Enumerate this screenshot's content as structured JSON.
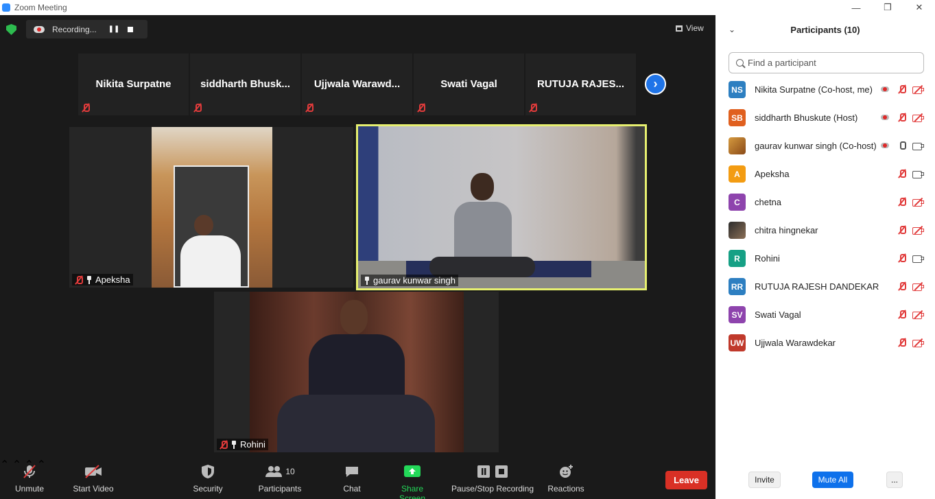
{
  "window": {
    "title": "Zoom Meeting",
    "minimize": "—",
    "restore": "❐",
    "close": "✕"
  },
  "recording": {
    "label": "Recording...",
    "pause": "❚❚"
  },
  "view": {
    "label": "View"
  },
  "thumbnails": [
    {
      "name": "Nikita Surpatne"
    },
    {
      "name": "siddharth  Bhusk..."
    },
    {
      "name": "Ujjwala  Warawd..."
    },
    {
      "name": "Swati Vagal"
    },
    {
      "name": "RUTUJA RAJES..."
    }
  ],
  "tiles": {
    "apeksha": {
      "name": "Apeksha"
    },
    "gaurav": {
      "name": "gaurav kunwar singh"
    },
    "rohini": {
      "name": "Rohini"
    }
  },
  "toolbar": {
    "unmute": "Unmute",
    "start_video": "Start Video",
    "security": "Security",
    "participants": "Participants",
    "participants_count": "10",
    "chat": "Chat",
    "share_screen": "Share Screen",
    "pause_stop_recording": "Pause/Stop Recording",
    "reactions": "Reactions",
    "leave": "Leave"
  },
  "colors": {
    "meeting_bg": "#1a1a1a",
    "active_speaker_border": "#e7f070",
    "share_green": "#23d959",
    "leave_red": "#d93025",
    "mute_red": "#e13b3b",
    "zoom_blue": "#0e71eb"
  },
  "panel": {
    "title": "Participants (10)",
    "search_placeholder": "Find a participant",
    "participants": [
      {
        "initials": "NS",
        "color": "#2d7fc1",
        "name": "Nikita Surpatne (Co-host, me)",
        "recording": true,
        "mic_on": false,
        "cam_on": false
      },
      {
        "initials": "SB",
        "color": "#e0601f",
        "name": "siddharth Bhuskute (Host)",
        "recording": true,
        "mic_on": false,
        "cam_on": false
      },
      {
        "initials": "",
        "color": "photo",
        "name": "gaurav kunwar singh (Co-host)",
        "recording": true,
        "mic_on": true,
        "cam_on": true
      },
      {
        "initials": "A",
        "color": "#f39c12",
        "name": "Apeksha",
        "recording": false,
        "mic_on": false,
        "cam_on": true
      },
      {
        "initials": "C",
        "color": "#8e44ad",
        "name": "chetna",
        "recording": false,
        "mic_on": false,
        "cam_on": false
      },
      {
        "initials": "",
        "color": "photo2",
        "name": "chitra hingnekar",
        "recording": false,
        "mic_on": false,
        "cam_on": false
      },
      {
        "initials": "R",
        "color": "#16a085",
        "name": "Rohini",
        "recording": false,
        "mic_on": false,
        "cam_on": true
      },
      {
        "initials": "RR",
        "color": "#2d7fc1",
        "name": "RUTUJA RAJESH DANDEKAR",
        "recording": false,
        "mic_on": false,
        "cam_on": false
      },
      {
        "initials": "SV",
        "color": "#8e44ad",
        "name": "Swati Vagal",
        "recording": false,
        "mic_on": false,
        "cam_on": false
      },
      {
        "initials": "UW",
        "color": "#c0392b",
        "name": "Ujjwala Warawdekar",
        "recording": false,
        "mic_on": false,
        "cam_on": false
      }
    ],
    "invite": "Invite",
    "mute_all": "Mute All",
    "more": "..."
  }
}
